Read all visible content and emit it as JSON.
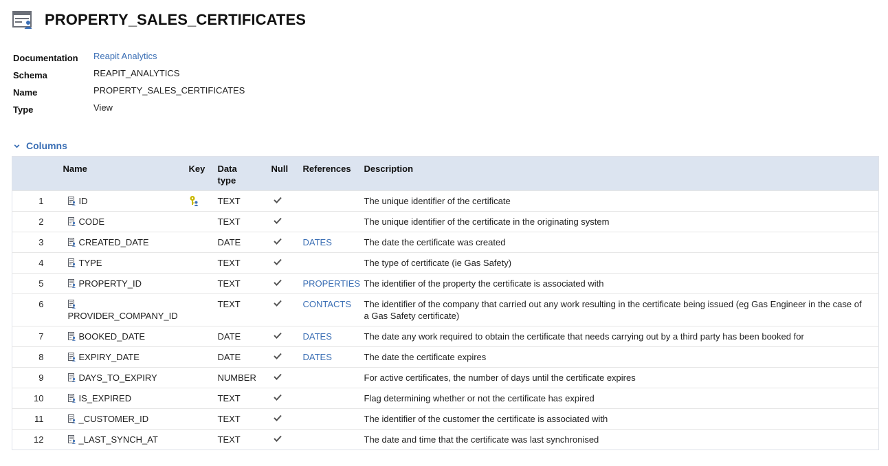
{
  "page": {
    "title": "PROPERTY_SALES_CERTIFICATES"
  },
  "properties": [
    {
      "label": "Documentation",
      "value": "Reapit Analytics",
      "link": true
    },
    {
      "label": "Schema",
      "value": "REAPIT_ANALYTICS",
      "link": false
    },
    {
      "label": "Name",
      "value": "PROPERTY_SALES_CERTIFICATES",
      "link": false
    },
    {
      "label": "Type",
      "value": "View",
      "link": false
    }
  ],
  "columns_section": {
    "title": "Columns",
    "headers": {
      "name": "Name",
      "key": "Key",
      "data_type": "Data type",
      "null": "Null",
      "references": "References",
      "description": "Description"
    }
  },
  "colors": {
    "accent": "#3b6fb5",
    "header_bg": "#dce4f0",
    "key_icon": "#c9b800"
  },
  "rows": [
    {
      "num": "1",
      "name": "ID",
      "key": true,
      "type": "TEXT",
      "null": true,
      "ref": "",
      "desc": "The unique identifier of the certificate"
    },
    {
      "num": "2",
      "name": "CODE",
      "key": false,
      "type": "TEXT",
      "null": true,
      "ref": "",
      "desc": "The unique identifier of the certificate in the originating system"
    },
    {
      "num": "3",
      "name": "CREATED_DATE",
      "key": false,
      "type": "DATE",
      "null": true,
      "ref": "DATES",
      "desc": "The date the certificate was created"
    },
    {
      "num": "4",
      "name": "TYPE",
      "key": false,
      "type": "TEXT",
      "null": true,
      "ref": "",
      "desc": "The type of certificate (ie Gas Safety)"
    },
    {
      "num": "5",
      "name": "PROPERTY_ID",
      "key": false,
      "type": "TEXT",
      "null": true,
      "ref": "PROPERTIES",
      "desc": "The identifier of the property the certificate is associated with"
    },
    {
      "num": "6",
      "name": "PROVIDER_COMPANY_ID",
      "key": false,
      "type": "TEXT",
      "null": true,
      "ref": "CONTACTS",
      "desc": "The identifier of the company that carried out any work resulting in the certificate being issued (eg Gas Engineer in the case of a Gas Safety certificate)"
    },
    {
      "num": "7",
      "name": "BOOKED_DATE",
      "key": false,
      "type": "DATE",
      "null": true,
      "ref": "DATES",
      "desc": "The date any work required to obtain the certificate that needs carrying out by a third party has been booked for"
    },
    {
      "num": "8",
      "name": "EXPIRY_DATE",
      "key": false,
      "type": "DATE",
      "null": true,
      "ref": "DATES",
      "desc": "The date the certificate expires"
    },
    {
      "num": "9",
      "name": "DAYS_TO_EXPIRY",
      "key": false,
      "type": "NUMBER",
      "null": true,
      "ref": "",
      "desc": "For active certificates, the number of days until the certificate expires"
    },
    {
      "num": "10",
      "name": "IS_EXPIRED",
      "key": false,
      "type": "TEXT",
      "null": true,
      "ref": "",
      "desc": "Flag determining whether or not the certificate has expired"
    },
    {
      "num": "11",
      "name": "_CUSTOMER_ID",
      "key": false,
      "type": "TEXT",
      "null": true,
      "ref": "",
      "desc": "The identifier of the customer the certificate is associated with"
    },
    {
      "num": "12",
      "name": "_LAST_SYNCH_AT",
      "key": false,
      "type": "TEXT",
      "null": true,
      "ref": "",
      "desc": "The date and time that the certificate was last synchronised"
    }
  ]
}
